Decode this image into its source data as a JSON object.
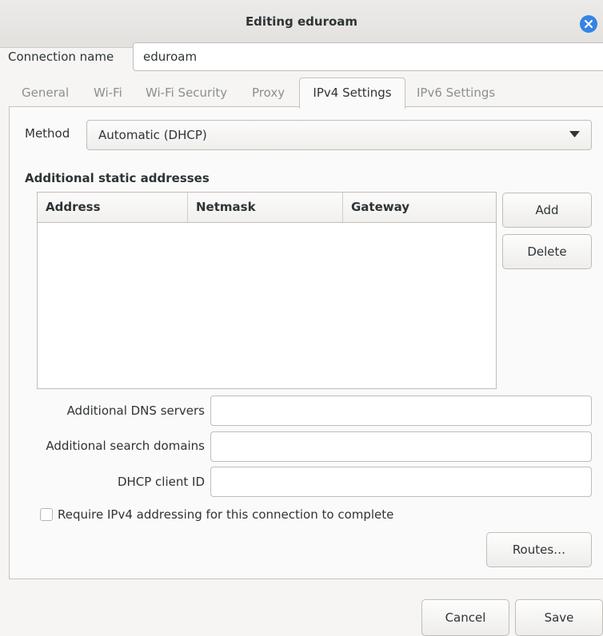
{
  "window": {
    "title": "Editing eduroam"
  },
  "connection": {
    "label": "Connection name",
    "value": "eduroam"
  },
  "tabs": [
    {
      "label": "General"
    },
    {
      "label": "Wi-Fi"
    },
    {
      "label": "Wi-Fi Security"
    },
    {
      "label": "Proxy"
    },
    {
      "label": "IPv4 Settings"
    },
    {
      "label": "IPv6 Settings"
    }
  ],
  "active_tab": "IPv4 Settings",
  "method": {
    "label": "Method",
    "selected": "Automatic (DHCP)"
  },
  "addresses": {
    "heading": "Additional static addresses",
    "columns": [
      "Address",
      "Netmask",
      "Gateway"
    ],
    "rows": []
  },
  "buttons": {
    "add": "Add",
    "delete": "Delete",
    "routes": "Routes…",
    "cancel": "Cancel",
    "save": "Save"
  },
  "fields": {
    "dns_label": "Additional DNS servers",
    "dns_value": "",
    "search_label": "Additional search domains",
    "search_value": "",
    "client_id_label": "DHCP client ID",
    "client_id_value": ""
  },
  "require_ipv4": {
    "label": "Require IPv4 addressing for this connection to complete",
    "checked": false
  },
  "icons": {
    "close": "close-icon",
    "dropdown": "chevron-down-icon"
  },
  "colors": {
    "accent": "#3584e4"
  }
}
